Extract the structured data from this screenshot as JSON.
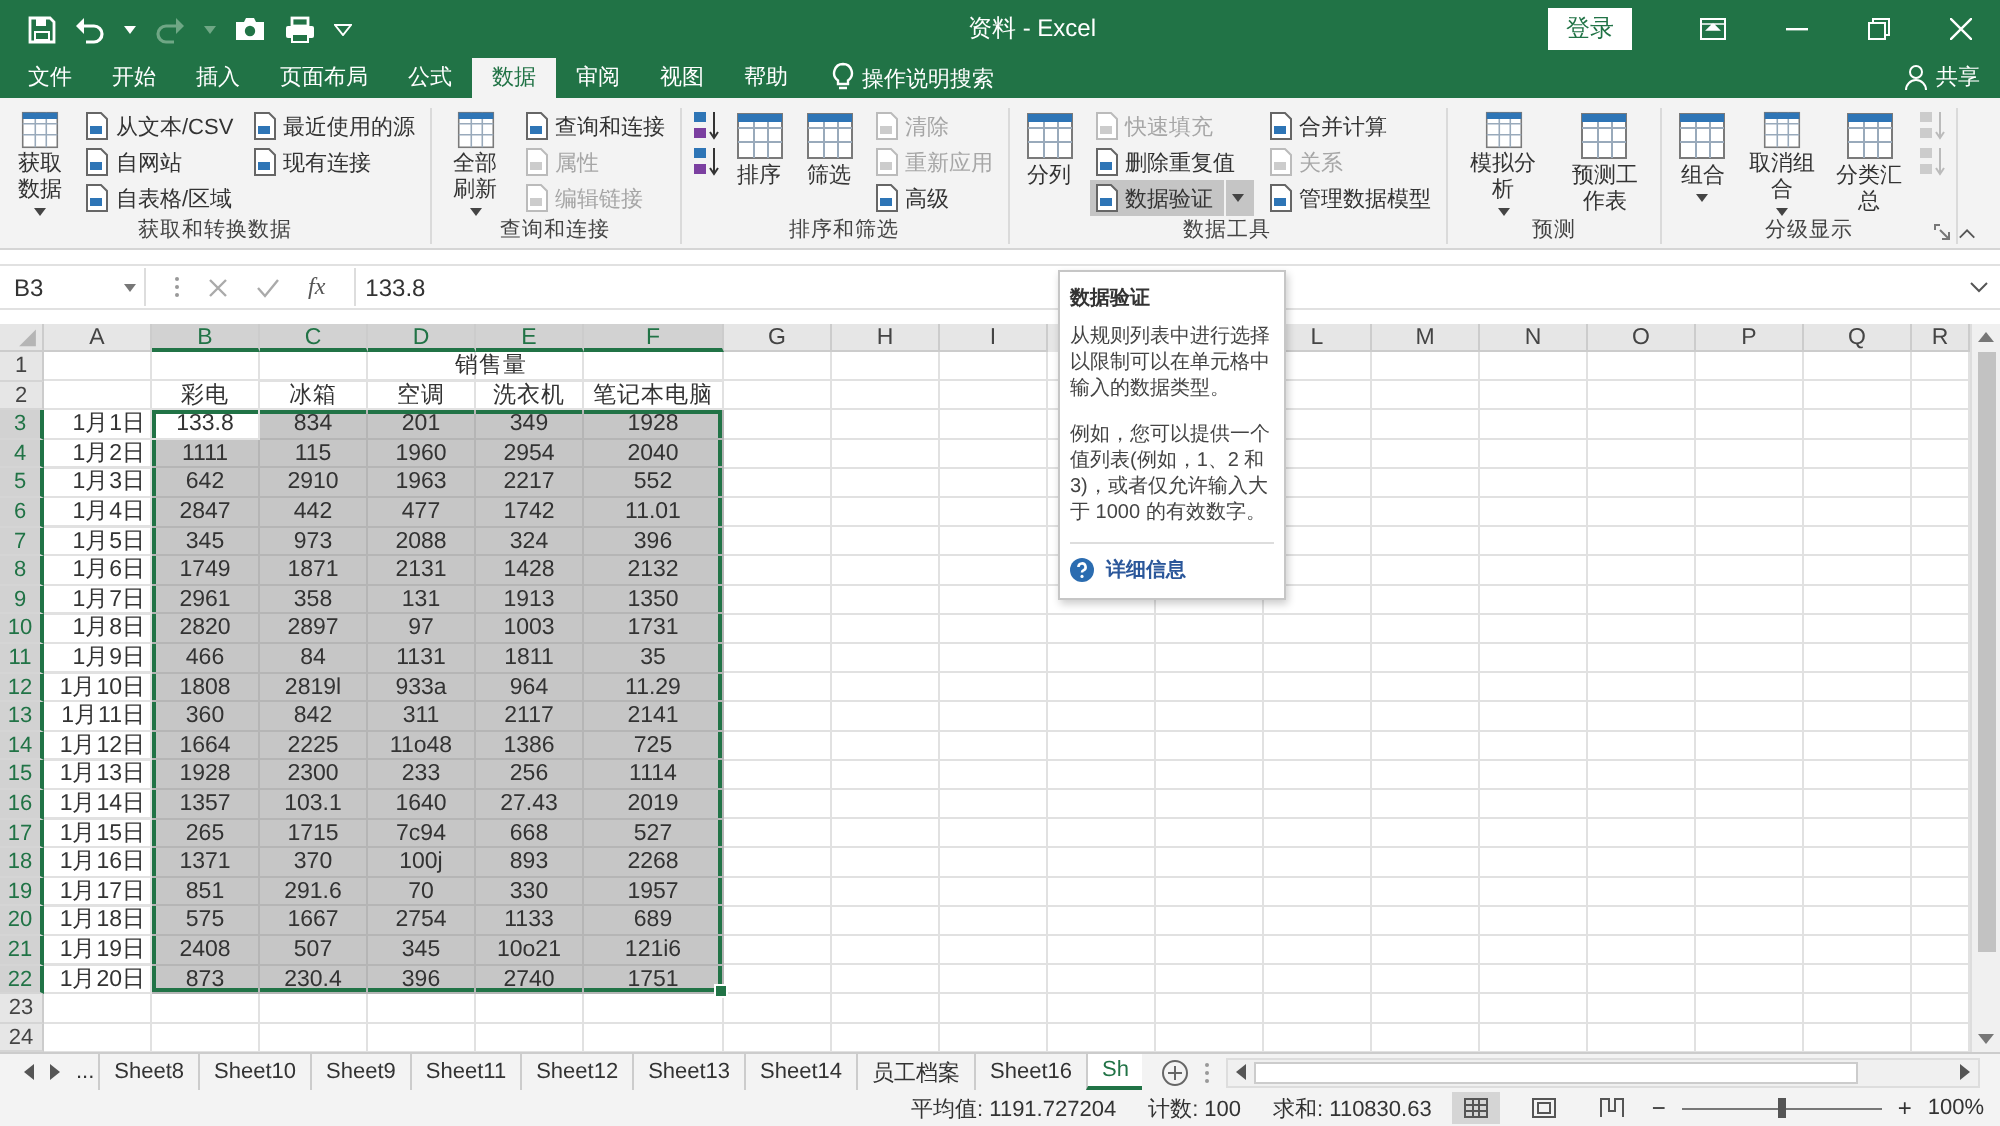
{
  "window": {
    "title": "资料 - Excel",
    "sign_in": "登录"
  },
  "tabs": [
    {
      "label": "文件",
      "selected": false
    },
    {
      "label": "开始",
      "selected": false
    },
    {
      "label": "插入",
      "selected": false
    },
    {
      "label": "页面布局",
      "selected": false
    },
    {
      "label": "公式",
      "selected": false
    },
    {
      "label": "数据",
      "selected": true
    },
    {
      "label": "审阅",
      "selected": false
    },
    {
      "label": "视图",
      "selected": false
    },
    {
      "label": "帮助",
      "selected": false
    }
  ],
  "search": {
    "placeholder": "操作说明搜索"
  },
  "share": "共享",
  "ribbon": {
    "groups": [
      {
        "label": "获取和转换数据",
        "launcher": false,
        "items": [
          {
            "kind": "large",
            "label": "获取数据",
            "dropdown": true,
            "disabled": false,
            "highlighted": false
          },
          {
            "kind": "small",
            "label": "从文本/CSV",
            "dropdown": false,
            "disabled": false,
            "highlighted": false
          },
          {
            "kind": "small",
            "label": "自网站",
            "dropdown": false,
            "disabled": false,
            "highlighted": false
          },
          {
            "kind": "small",
            "label": "自表格/区域",
            "dropdown": false,
            "disabled": false,
            "highlighted": false
          },
          {
            "kind": "small",
            "label": "最近使用的源",
            "dropdown": false,
            "disabled": false,
            "highlighted": false
          },
          {
            "kind": "small",
            "label": "现有连接",
            "dropdown": false,
            "disabled": false,
            "highlighted": false
          }
        ]
      },
      {
        "label": "查询和连接",
        "launcher": false,
        "items": [
          {
            "kind": "large",
            "label": "全部刷新",
            "dropdown": true,
            "disabled": false,
            "highlighted": false
          },
          {
            "kind": "small",
            "label": "查询和连接",
            "dropdown": false,
            "disabled": false,
            "highlighted": false
          },
          {
            "kind": "small",
            "label": "属性",
            "dropdown": false,
            "disabled": true,
            "highlighted": false
          },
          {
            "kind": "small",
            "label": "编辑链接",
            "dropdown": false,
            "disabled": true,
            "highlighted": false
          }
        ]
      },
      {
        "label": "排序和筛选",
        "launcher": false,
        "items": [
          {
            "kind": "icon",
            "dropdown": false,
            "disabled": false,
            "highlighted": false
          },
          {
            "kind": "icon",
            "dropdown": false,
            "disabled": false,
            "highlighted": false
          },
          {
            "kind": "large",
            "label": "排序",
            "dropdown": false,
            "disabled": false,
            "highlighted": false
          },
          {
            "kind": "large",
            "label": "筛选",
            "dropdown": false,
            "disabled": false,
            "highlighted": false
          },
          {
            "kind": "small",
            "label": "清除",
            "dropdown": false,
            "disabled": true,
            "highlighted": false
          },
          {
            "kind": "small",
            "label": "重新应用",
            "dropdown": false,
            "disabled": true,
            "highlighted": false
          },
          {
            "kind": "small",
            "label": "高级",
            "dropdown": false,
            "disabled": false,
            "highlighted": false
          }
        ]
      },
      {
        "label": "数据工具",
        "launcher": false,
        "items": [
          {
            "kind": "large",
            "label": "分列",
            "dropdown": false,
            "disabled": false,
            "highlighted": false
          },
          {
            "kind": "small",
            "label": "快速填充",
            "dropdown": false,
            "disabled": true,
            "highlighted": false
          },
          {
            "kind": "small",
            "label": "删除重复值",
            "dropdown": false,
            "disabled": false,
            "highlighted": false
          },
          {
            "kind": "small",
            "label": "数据验证",
            "dropdown": true,
            "disabled": false,
            "highlighted": true
          },
          {
            "kind": "small",
            "label": "合并计算",
            "dropdown": false,
            "disabled": false,
            "highlighted": false
          },
          {
            "kind": "small",
            "label": "关系",
            "dropdown": false,
            "disabled": true,
            "highlighted": false
          },
          {
            "kind": "small",
            "label": "管理数据模型",
            "dropdown": false,
            "disabled": false,
            "highlighted": false
          }
        ]
      },
      {
        "label": "预测",
        "launcher": false,
        "items": [
          {
            "kind": "large",
            "label": "模拟分析",
            "dropdown": true,
            "disabled": false,
            "highlighted": false
          },
          {
            "kind": "large",
            "label": "预测工作表",
            "dropdown": false,
            "disabled": false,
            "highlighted": false
          }
        ]
      },
      {
        "label": "分级显示",
        "launcher": true,
        "items": [
          {
            "kind": "large",
            "label": "组合",
            "dropdown": true,
            "disabled": false,
            "highlighted": false
          },
          {
            "kind": "large",
            "label": "取消组合",
            "dropdown": true,
            "disabled": false,
            "highlighted": false
          },
          {
            "kind": "large",
            "label": "分类汇总",
            "dropdown": false,
            "disabled": false,
            "highlighted": false
          },
          {
            "kind": "icon",
            "dropdown": false,
            "disabled": true,
            "highlighted": false
          },
          {
            "kind": "icon",
            "dropdown": false,
            "disabled": true,
            "highlighted": false
          }
        ]
      }
    ]
  },
  "formula_bar": {
    "name_box": "B3",
    "function_label": "fx",
    "value": "133.8"
  },
  "tooltip": {
    "title": "数据验证",
    "paragraphs": [
      "从规则列表中进行选择以限制可以在单元格中输入的数据类型。",
      "例如，您可以提供一个值列表(例如，1、2 和 3)，或者仅允许输入大于 1000 的有效数字。"
    ],
    "link": "详细信息"
  },
  "sheet": {
    "columns": [
      {
        "label": "A",
        "selected": false
      },
      {
        "label": "B",
        "selected": true
      },
      {
        "label": "C",
        "selected": true
      },
      {
        "label": "D",
        "selected": true
      },
      {
        "label": "E",
        "selected": true
      },
      {
        "label": "F",
        "selected": true
      },
      {
        "label": "G",
        "selected": false
      },
      {
        "label": "H",
        "selected": false
      },
      {
        "label": "I",
        "selected": false
      },
      {},
      {},
      {
        "label": "L",
        "selected": false
      },
      {
        "label": "M",
        "selected": false
      },
      {
        "label": "N",
        "selected": false
      },
      {
        "label": "O",
        "selected": false
      },
      {
        "label": "P",
        "selected": false
      },
      {
        "label": "Q",
        "selected": false
      },
      {
        "label": "R",
        "selected": false
      }
    ],
    "rows": [
      {
        "kind": "title",
        "number": "1",
        "selected": false,
        "text": "销售量"
      },
      {
        "kind": "header",
        "number": "2",
        "selected": false,
        "values": [
          "彩电",
          "冰箱",
          "空调",
          "洗衣机",
          "笔记本电脑"
        ]
      },
      {
        "kind": "data",
        "number": "3",
        "selected": true,
        "label": "1月1日",
        "values": [
          "133.8",
          "834",
          "201",
          "349",
          "1928"
        ],
        "active": [
          true,
          false,
          false,
          false,
          false
        ]
      },
      {
        "kind": "data",
        "number": "4",
        "selected": true,
        "label": "1月2日",
        "values": [
          "1111",
          "115",
          "1960",
          "2954",
          "2040"
        ],
        "active": [
          false,
          false,
          false,
          false,
          false
        ]
      },
      {
        "kind": "data",
        "number": "5",
        "selected": true,
        "label": "1月3日",
        "values": [
          "642",
          "2910",
          "1963",
          "2217",
          "552"
        ],
        "active": [
          false,
          false,
          false,
          false,
          false
        ]
      },
      {
        "kind": "data",
        "number": "6",
        "selected": true,
        "label": "1月4日",
        "values": [
          "2847",
          "442",
          "477",
          "1742",
          "11.01"
        ],
        "active": [
          false,
          false,
          false,
          false,
          false
        ]
      },
      {
        "kind": "data",
        "number": "7",
        "selected": true,
        "label": "1月5日",
        "values": [
          "345",
          "973",
          "2088",
          "324",
          "396"
        ],
        "active": [
          false,
          false,
          false,
          false,
          false
        ]
      },
      {
        "kind": "data",
        "number": "8",
        "selected": true,
        "label": "1月6日",
        "values": [
          "1749",
          "1871",
          "2131",
          "1428",
          "2132"
        ],
        "active": [
          false,
          false,
          false,
          false,
          false
        ]
      },
      {
        "kind": "data",
        "number": "9",
        "selected": true,
        "label": "1月7日",
        "values": [
          "2961",
          "358",
          "131",
          "1913",
          "1350"
        ],
        "active": [
          false,
          false,
          false,
          false,
          false
        ]
      },
      {
        "kind": "data",
        "number": "10",
        "selected": true,
        "label": "1月8日",
        "values": [
          "2820",
          "2897",
          "97",
          "1003",
          "1731"
        ],
        "active": [
          false,
          false,
          false,
          false,
          false
        ]
      },
      {
        "kind": "data",
        "number": "11",
        "selected": true,
        "label": "1月9日",
        "values": [
          "466",
          "84",
          "1131",
          "1811",
          "35"
        ],
        "active": [
          false,
          false,
          false,
          false,
          false
        ]
      },
      {
        "kind": "data",
        "number": "12",
        "selected": true,
        "label": "1月10日",
        "values": [
          "1808",
          "2819l",
          "933a",
          "964",
          "11.29"
        ],
        "active": [
          false,
          false,
          false,
          false,
          false
        ]
      },
      {
        "kind": "data",
        "number": "13",
        "selected": true,
        "label": "1月11日",
        "values": [
          "360",
          "842",
          "311",
          "2117",
          "2141"
        ],
        "active": [
          false,
          false,
          false,
          false,
          false
        ]
      },
      {
        "kind": "data",
        "number": "14",
        "selected": true,
        "label": "1月12日",
        "values": [
          "1664",
          "2225",
          "11o48",
          "1386",
          "725"
        ],
        "active": [
          false,
          false,
          false,
          false,
          false
        ]
      },
      {
        "kind": "data",
        "number": "15",
        "selected": true,
        "label": "1月13日",
        "values": [
          "1928",
          "2300",
          "233",
          "256",
          "1114"
        ],
        "active": [
          false,
          false,
          false,
          false,
          false
        ]
      },
      {
        "kind": "data",
        "number": "16",
        "selected": true,
        "label": "1月14日",
        "values": [
          "1357",
          "103.1",
          "1640",
          "27.43",
          "2019"
        ],
        "active": [
          false,
          false,
          false,
          false,
          false
        ]
      },
      {
        "kind": "data",
        "number": "17",
        "selected": true,
        "label": "1月15日",
        "values": [
          "265",
          "1715",
          "7c94",
          "668",
          "527"
        ],
        "active": [
          false,
          false,
          false,
          false,
          false
        ]
      },
      {
        "kind": "data",
        "number": "18",
        "selected": true,
        "label": "1月16日",
        "values": [
          "1371",
          "370",
          "100j",
          "893",
          "2268"
        ],
        "active": [
          false,
          false,
          false,
          false,
          false
        ]
      },
      {
        "kind": "data",
        "number": "19",
        "selected": true,
        "label": "1月17日",
        "values": [
          "851",
          "291.6",
          "70",
          "330",
          "1957"
        ],
        "active": [
          false,
          false,
          false,
          false,
          false
        ]
      },
      {
        "kind": "data",
        "number": "20",
        "selected": true,
        "label": "1月18日",
        "values": [
          "575",
          "1667",
          "2754",
          "1133",
          "689"
        ],
        "active": [
          false,
          false,
          false,
          false,
          false
        ]
      },
      {
        "kind": "data",
        "number": "21",
        "selected": true,
        "label": "1月19日",
        "values": [
          "2408",
          "507",
          "345",
          "10o21",
          "121i6"
        ],
        "active": [
          false,
          false,
          false,
          false,
          false
        ]
      },
      {
        "kind": "data",
        "number": "22",
        "selected": true,
        "label": "1月20日",
        "values": [
          "873",
          "230.4",
          "396",
          "2740",
          "1751"
        ],
        "active": [
          false,
          false,
          false,
          false,
          false
        ]
      },
      {
        "kind": "empty",
        "number": "23",
        "selected": false
      },
      {
        "kind": "empty",
        "number": "24",
        "selected": false
      }
    ]
  },
  "sheet_tabs": {
    "more": "...",
    "tabs": [
      {
        "label": "Sheet8",
        "selected": false
      },
      {
        "label": "Sheet10",
        "selected": false
      },
      {
        "label": "Sheet9",
        "selected": false
      },
      {
        "label": "Sheet11",
        "selected": false
      },
      {
        "label": "Sheet12",
        "selected": false
      },
      {
        "label": "Sheet13",
        "selected": false
      },
      {
        "label": "Sheet14",
        "selected": false
      },
      {
        "label": "员工档案",
        "selected": false
      },
      {
        "label": "Sheet16",
        "selected": false
      },
      {
        "label": "Sh",
        "selected": true
      }
    ]
  },
  "status_bar": {
    "stats": [
      "平均值: 1191.727204",
      "计数: 100",
      "求和: 110830.63"
    ],
    "views": [
      {
        "selected": true
      },
      {
        "selected": false
      },
      {
        "selected": false
      }
    ],
    "zoom": {
      "minus": "−",
      "plus": "+",
      "level": 0.5,
      "reading": "100%"
    }
  }
}
